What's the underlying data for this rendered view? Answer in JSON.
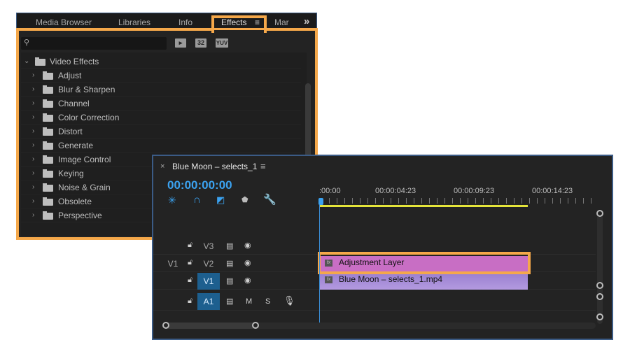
{
  "effects_panel": {
    "tabs": [
      {
        "label": "Media Browser"
      },
      {
        "label": "Libraries"
      },
      {
        "label": "Info"
      },
      {
        "label": "Effects",
        "active": true
      },
      {
        "label": "Mar"
      }
    ],
    "overflow": "»",
    "menu_icon": "≡",
    "search": {
      "placeholder": "",
      "value": ""
    },
    "toolbar": [
      "32",
      "YUV"
    ],
    "tree": {
      "root": "Video Effects",
      "items": [
        "Adjust",
        "Blur & Sharpen",
        "Channel",
        "Color Correction",
        "Distort",
        "Generate",
        "Image Control",
        "Keying",
        "Noise & Grain",
        "Obsolete",
        "Perspective"
      ]
    }
  },
  "timeline": {
    "title": "Blue Moon – selects_1",
    "close": "×",
    "menu_icon": "≡",
    "timecode": "00:00:00:00",
    "ruler": [
      ":00:00",
      "00:00:04:23",
      "00:00:09:23",
      "00:00:14:23"
    ],
    "tracks": {
      "v3": "V3",
      "v2": "V2",
      "v1": "V1",
      "a1": "A1",
      "source_v1": "V1",
      "mute": "M",
      "solo": "S"
    },
    "clips": [
      {
        "name": "Adjustment Layer",
        "color": "#c86ec4",
        "fx": "fx"
      },
      {
        "name": "Blue Moon – selects_1.mp4",
        "color": "#a98ad8",
        "fx": "fx"
      }
    ]
  },
  "colors": {
    "highlight": "#f5a84a",
    "accent": "#3ba2f0",
    "work_area": "#e4e43a"
  }
}
